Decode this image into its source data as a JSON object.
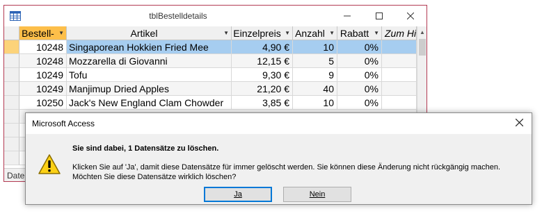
{
  "table_window": {
    "title": "tblBestelldetails",
    "columns": [
      {
        "label": "Bestell-",
        "has_dropdown": true
      },
      {
        "label": "Artikel",
        "has_dropdown": true
      },
      {
        "label": "Einzelpreis",
        "has_dropdown": true
      },
      {
        "label": "Anzahl",
        "has_dropdown": true
      },
      {
        "label": "Rabatt",
        "has_dropdown": true
      },
      {
        "label": "Zum Hin",
        "has_dropdown": false
      }
    ],
    "rows": [
      {
        "bestell": "10248",
        "artikel": "Singaporean Hokkien Fried Mee",
        "einzelpreis": "4,90 €",
        "anzahl": "10",
        "rabatt": "0%",
        "selected": true
      },
      {
        "bestell": "10248",
        "artikel": "Mozzarella di Giovanni",
        "einzelpreis": "12,15 €",
        "anzahl": "5",
        "rabatt": "0%",
        "selected": false
      },
      {
        "bestell": "10249",
        "artikel": "Tofu",
        "einzelpreis": "9,30 €",
        "anzahl": "9",
        "rabatt": "0%",
        "selected": false
      },
      {
        "bestell": "10249",
        "artikel": "Manjimup Dried Apples",
        "einzelpreis": "21,20 €",
        "anzahl": "40",
        "rabatt": "0%",
        "selected": false
      },
      {
        "bestell": "10250",
        "artikel": "Jack's New England Clam Chowder",
        "einzelpreis": "3,85 €",
        "anzahl": "10",
        "rabatt": "0%",
        "selected": false
      }
    ],
    "status_text": "Date",
    "icons": {
      "app": "table-icon",
      "minimize": "minimize-icon",
      "maximize": "maximize-icon",
      "close": "close-icon"
    },
    "colors": {
      "border": "#b33a52",
      "selected_row": "#a6cdf0",
      "selected_header": "#fdbf4a"
    }
  },
  "dialog": {
    "title": "Microsoft Access",
    "heading": "Sie sind dabei, 1 Datensätze zu löschen.",
    "line1": "Klicken Sie auf 'Ja', damit diese Datensätze für immer gelöscht werden. Sie können diese Änderung nicht rückgängig machen.",
    "line2": "Möchten Sie diese Datensätze wirklich löschen?",
    "buttons": {
      "yes": "Ja",
      "no": "Nein"
    },
    "icons": {
      "warning": "warning-icon",
      "close": "close-icon"
    }
  }
}
